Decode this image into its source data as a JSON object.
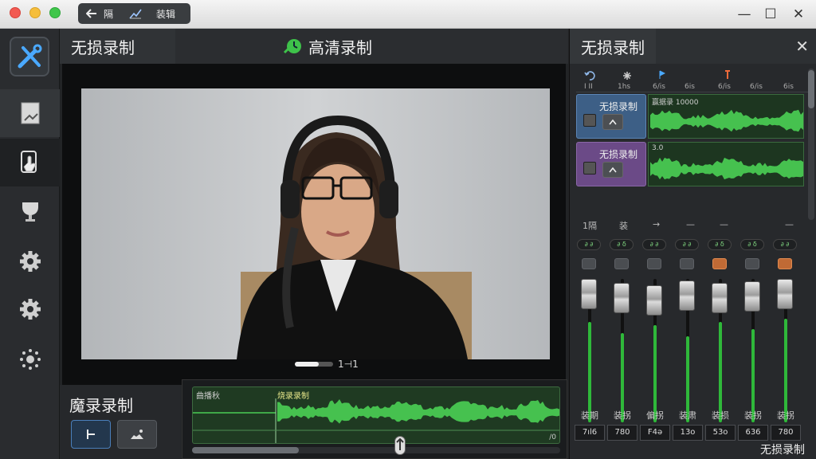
{
  "titlebar": {
    "back_label": "隔",
    "chart_label": "",
    "edit_label": "装辑",
    "minimize_symbol": "—",
    "maximize_symbol": "☐",
    "close_symbol": "✕"
  },
  "center": {
    "left_tab": "无损录制",
    "title": "高清录制",
    "video_time": "1⊣1",
    "recording_label": "魔录录制"
  },
  "wave": {
    "left_label": "曲播秋",
    "clip_label": "烧录录制",
    "end_label": "/0"
  },
  "mixer": {
    "title": "无损录制",
    "close_symbol": "✕",
    "ruler": [
      "I II",
      "1hs",
      "6/is",
      "6is",
      "6/is",
      "6/is",
      "6is"
    ],
    "tracks": [
      {
        "name": "无损录制",
        "info": "赢据录 10000",
        "color": "#3d5f86"
      },
      {
        "name": "无损录制",
        "info": "3.0",
        "color": "#6b4a87"
      }
    ],
    "tools": [
      "1隔",
      "装",
      "→",
      "—",
      "—",
      "—"
    ],
    "strips": [
      {
        "label": "装期",
        "value": "7ıl6",
        "knob": "∂ ∂",
        "orange": false,
        "level": 0.7
      },
      {
        "label": "装拐",
        "value": "780",
        "knob": "∂ δ",
        "orange": false,
        "level": 0.62
      },
      {
        "label": "偏拐",
        "value": "F4ə",
        "knob": "∂ ∂",
        "orange": false,
        "level": 0.68
      },
      {
        "label": "装肃",
        "value": "13o",
        "knob": "∂ ∂",
        "orange": false,
        "level": 0.6
      },
      {
        "label": "装损",
        "value": "53o",
        "knob": "∂ δ",
        "orange": true,
        "level": 0.7
      },
      {
        "label": "装拐",
        "value": "636",
        "knob": "∂ δ",
        "orange": false,
        "level": 0.65
      },
      {
        "label": "装拐",
        "value": "780",
        "knob": "∂ ∂",
        "orange": true,
        "level": 0.72
      }
    ],
    "footer": "无损录制"
  },
  "colors": {
    "accent_green": "#2fb83a",
    "track_blue": "#3d5f86",
    "track_purple": "#6b4a87",
    "orange": "#c06a35"
  }
}
